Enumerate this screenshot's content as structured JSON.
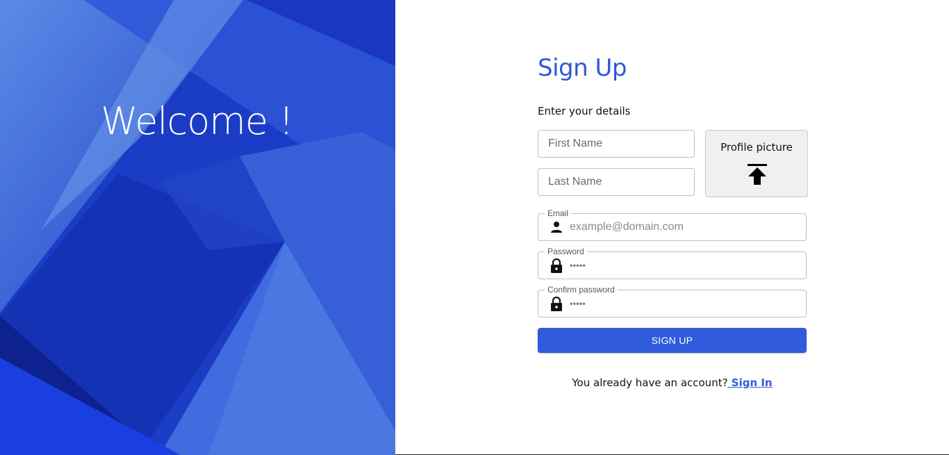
{
  "hero": {
    "heading": "Welcome !"
  },
  "form": {
    "title": "Sign Up",
    "subtitle": "Enter your details",
    "first_name": {
      "placeholder": "First Name"
    },
    "last_name": {
      "placeholder": "Last Name"
    },
    "profile_picture": {
      "label": "Profile picture",
      "icon": "upload-icon"
    },
    "email": {
      "label": "Email",
      "placeholder": "example@domain.com",
      "icon": "person-icon"
    },
    "password": {
      "label": "Password",
      "value": "•••••",
      "icon": "lock-icon"
    },
    "confirm_password": {
      "label": "Confirm password",
      "value": "•••••",
      "icon": "lock-icon"
    },
    "submit_label": "SIGN UP",
    "footer_text": "You already have an account?",
    "signin_link": " Sign In"
  },
  "colors": {
    "accent": "#2f5bdc",
    "hero_blue": "#1d3fc7"
  }
}
